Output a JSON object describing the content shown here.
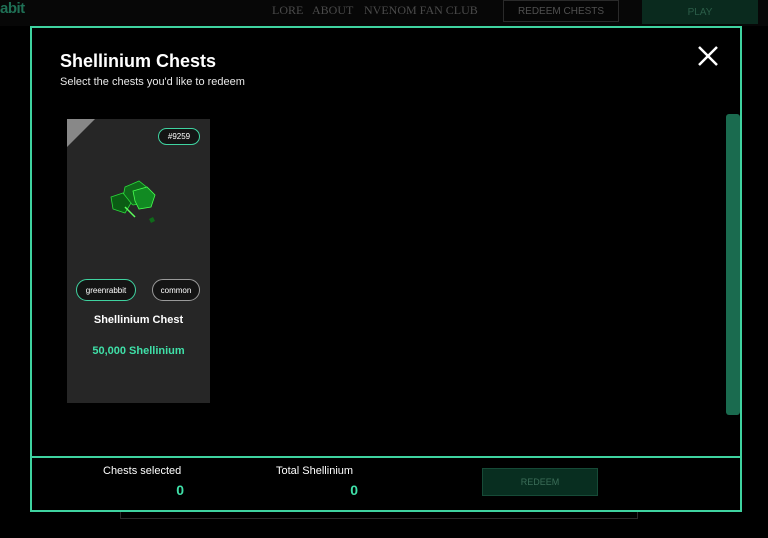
{
  "background": {
    "logo": "abit",
    "nav": [
      "LORE",
      "ABOUT",
      "NVENOM FAN CLUB"
    ],
    "redeem_chests_label": "REDEEM CHESTS",
    "play_label": "PLAY"
  },
  "modal": {
    "title": "Shellinium Chests",
    "subtitle": "Select the chests you'd like to redeem",
    "close_icon": "close-icon",
    "cards": [
      {
        "id": "#9259",
        "owner": "greenrabbit",
        "rarity": "common",
        "name": "Shellinium Chest",
        "amount": "50,000 Shellinium"
      }
    ],
    "footer": {
      "chests_selected_label": "Chests selected",
      "chests_selected_value": "0",
      "total_label": "Total Shellinium",
      "total_value": "0",
      "redeem_label": "REDEEM"
    }
  },
  "colors": {
    "accent": "#3fd3a0",
    "value_text": "#3fe0a8",
    "card_bg": "#262626"
  }
}
